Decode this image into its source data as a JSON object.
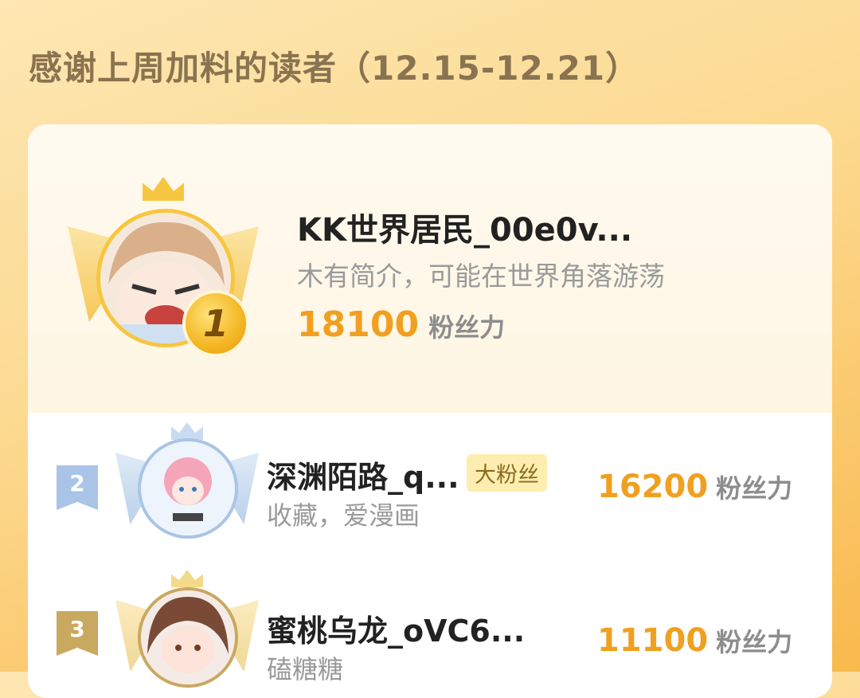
{
  "header": {
    "title": "感谢上周加料的读者（12.15-12.21）"
  },
  "top_reader": {
    "rank": "1",
    "name": "KK世界居民_00e0v...",
    "bio": "木有简介，可能在世界角落游荡",
    "score": "18100",
    "score_unit": "粉丝力"
  },
  "readers": [
    {
      "rank": "2",
      "name": "深渊陌路_q...",
      "badge": "大粉丝",
      "bio": "收藏，爱漫画",
      "score": "16200",
      "score_unit": "粉丝力"
    },
    {
      "rank": "3",
      "name": "蜜桃乌龙_oVC6...",
      "bio": "磕糖糖",
      "score": "11100",
      "score_unit": "粉丝力"
    }
  ],
  "colors": {
    "accent": "#f0a020",
    "rank2_flag": "#a9c4e6",
    "rank3_flag": "#c9a860",
    "badge_bg": "#fdeeb0"
  }
}
